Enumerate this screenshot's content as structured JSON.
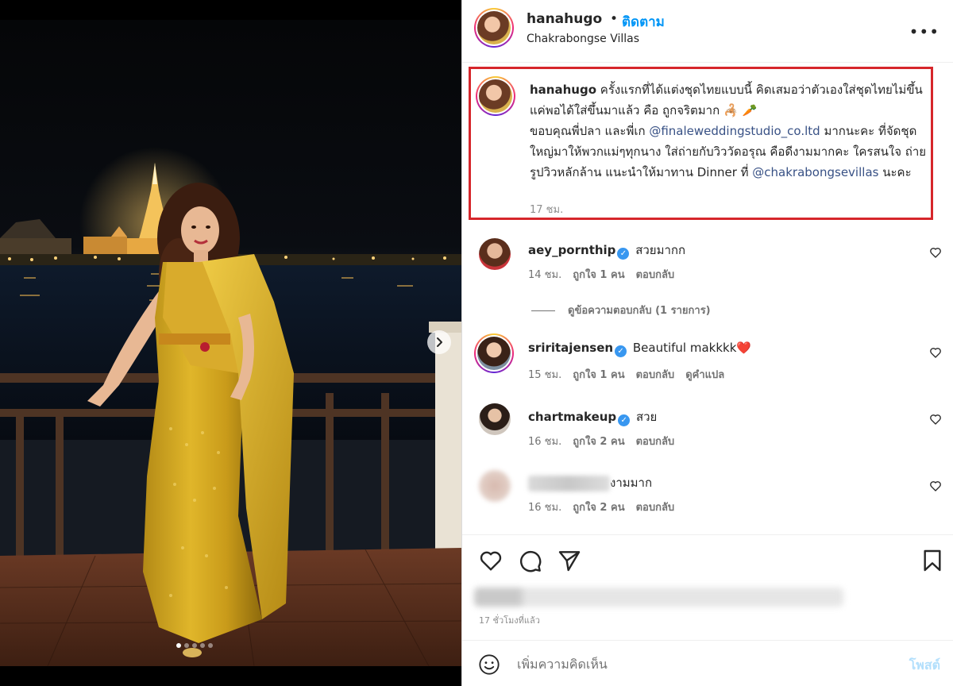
{
  "post": {
    "username": "hanahugo",
    "separator": "•",
    "follow_label": "ติดตาม",
    "location": "Chakrabongse Villas",
    "more_icon": "more-horizontal-icon"
  },
  "caption": {
    "username": "hanahugo",
    "text_1": " ครั้งแรกที่ได้แต่งชุดไทยแบบนี้ คิดเสมอว่าตัวเองใส่ชุดไทยไม่ขึ้น แค่พอได้ใส่ขึ้นมาแล้ว คือ ถูกจริตมาก ",
    "emoji_1": "🦂",
    "emoji_2": "🥕",
    "text_2": "ขอบคุณพี่ปลา และพี่เก ",
    "mention_1": "@finaleweddingstudio_co.ltd",
    "text_3": " มากนะคะ ที่จัดชุดใหญ่มาให้พวกแม่ๆทุกนาง ใส่ถ่ายกับวิววัดอรุณ คือดีงามมากคะ ใครสนใจ ถ่ายรูปวิวหลักล้าน แนะนำให้มาทาน Dinner ที่ ",
    "mention_2": "@chakrabongsevillas",
    "text_4": " นะคะ",
    "time": "17 ชม."
  },
  "comments": [
    {
      "username": "aey_pornthip",
      "verified": true,
      "text": "สวยมากก",
      "time": "14 ชม.",
      "likes": "ถูกใจ 1 คน",
      "reply": "ตอบกลับ",
      "translate": ""
    },
    {
      "username": "sriritajensen",
      "verified": true,
      "text": "Beautiful makkkk",
      "emoji": "❤️",
      "time": "15 ชม.",
      "likes": "ถูกใจ 1 คน",
      "reply": "ตอบกลับ",
      "translate": "ดูคำแปล"
    },
    {
      "username": "chartmakeup",
      "verified": true,
      "text": "สวย",
      "time": "16 ชม.",
      "likes": "ถูกใจ 2 คน",
      "reply": "ตอบกลับ",
      "translate": ""
    },
    {
      "username": "",
      "verified": false,
      "text": "งามมาก",
      "time": "16 ชม.",
      "likes": "ถูกใจ 2 คน",
      "reply": "ตอบกลับ",
      "translate": ""
    }
  ],
  "view_replies": "ดูข้อความตอบกลับ (1 รายการ)",
  "actions": {
    "like_icon": "heart-icon",
    "comment_icon": "comment-bubble-icon",
    "share_icon": "paper-plane-icon",
    "save_icon": "bookmark-icon"
  },
  "posted_ago": "17 ชั่วโมงที่แล้ว",
  "add_comment": {
    "placeholder": "เพิ่มความคิดเห็น",
    "post_label": "โพสต์",
    "emoji_icon": "smiley-icon"
  },
  "carousel": {
    "slides": 5,
    "active_index": 0
  },
  "colors": {
    "accent": "#0095f6",
    "highlight_box": "#d6262b",
    "mention": "#385185",
    "verified": "#3897f0"
  }
}
